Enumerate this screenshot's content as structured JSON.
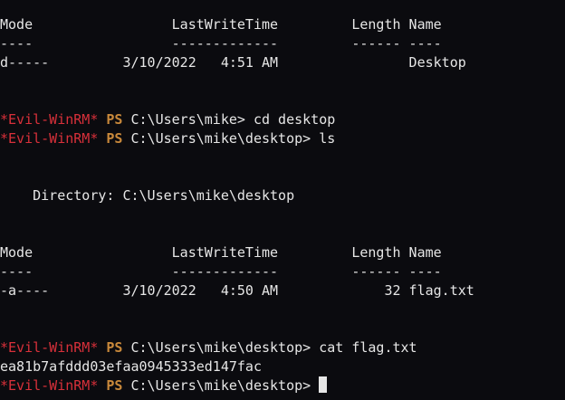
{
  "prompt": {
    "app": "*Evil-WinRM*",
    "shell": "PS",
    "home_path": "C:\\Users\\mike>",
    "desktop_path": "C:\\Users\\mike\\desktop>"
  },
  "listing1": {
    "header": "Mode                 LastWriteTime         Length Name",
    "separator": "----                 -------------         ------ ----",
    "row": "d-----         3/10/2022   4:51 AM                Desktop"
  },
  "commands": {
    "cd": "cd desktop",
    "ls": "ls",
    "cat": "cat flag.txt"
  },
  "directory_line": "    Directory: C:\\Users\\mike\\desktop",
  "listing2": {
    "header": "Mode                 LastWriteTime         Length Name",
    "separator": "----                 -------------         ------ ----",
    "row": "-a----         3/10/2022   4:50 AM             32 flag.txt"
  },
  "flag_output": "ea81b7afddd03efaa0945333ed147fac"
}
